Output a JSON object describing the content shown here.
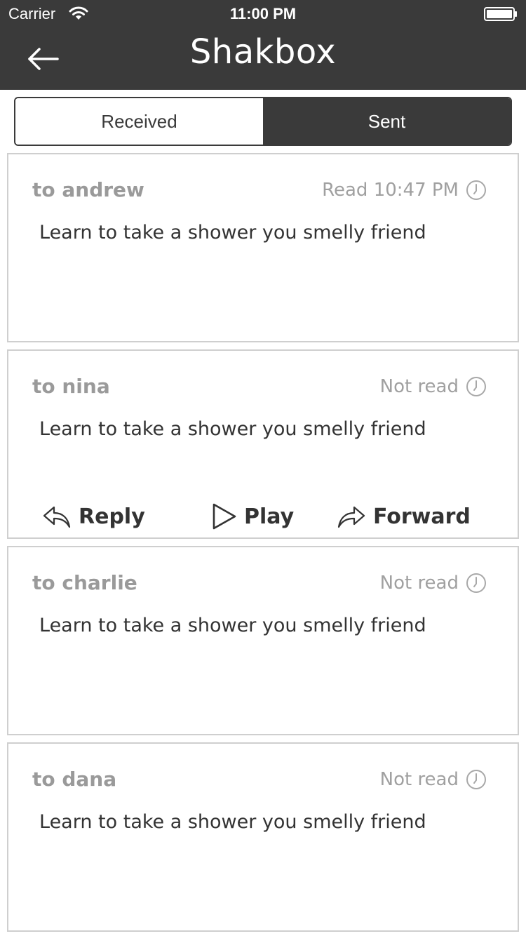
{
  "status_bar": {
    "carrier": "Carrier",
    "time": "11:00 PM",
    "wifi_icon": "wifi-icon",
    "battery_icon": "battery-icon"
  },
  "header": {
    "title": "Shakbox",
    "back_icon": "arrow-left-icon",
    "background": "#3a3a3a"
  },
  "tabs": [
    {
      "label": "Received",
      "selected": false
    },
    {
      "label": "Sent",
      "selected": true
    }
  ],
  "messages": [
    {
      "recipient": "to andrew",
      "status": "Read 10:47 PM",
      "text": "Learn to take a shower you smelly friend",
      "expanded": false
    },
    {
      "recipient": "to nina",
      "status": "Not read",
      "text": "Learn to take a shower you smelly friend",
      "expanded": true
    },
    {
      "recipient": "to charlie",
      "status": "Not read",
      "text": "Learn to take a shower you smelly friend",
      "expanded": false
    },
    {
      "recipient": "to dana",
      "status": "Not read",
      "text": "Learn to take a shower you smelly friend",
      "expanded": false
    }
  ],
  "actions": {
    "reply": "Reply",
    "play": "Play",
    "forward": "Forward"
  },
  "colors": {
    "dark": "#3a3a3a",
    "muted_text": "#9a9a9a",
    "body_text": "#333333",
    "card_border": "#cfcfcf"
  }
}
